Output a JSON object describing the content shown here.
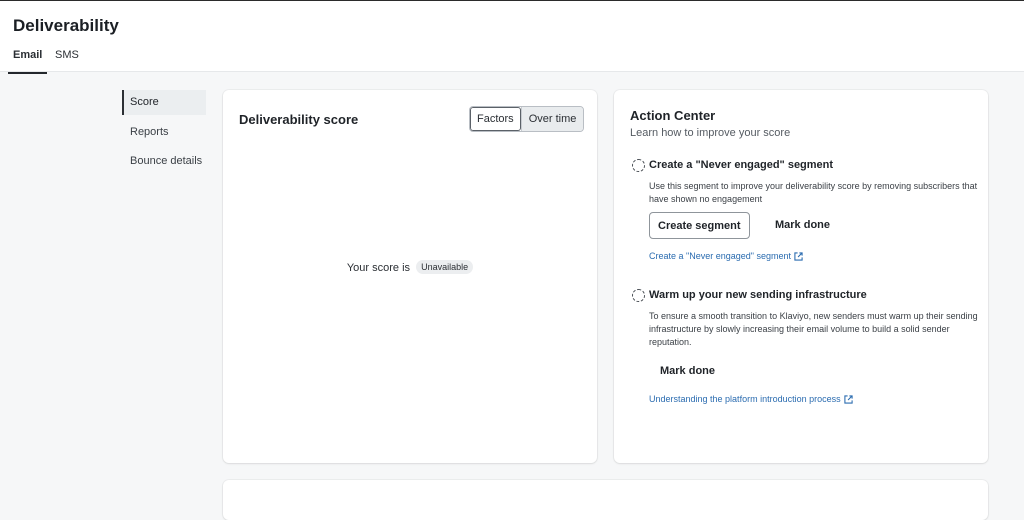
{
  "header": {
    "title": "Deliverability",
    "tabs": [
      {
        "label": "Email",
        "active": true
      },
      {
        "label": "SMS",
        "active": false
      }
    ]
  },
  "sidenav": {
    "items": [
      {
        "label": "Score",
        "active": true
      },
      {
        "label": "Reports",
        "active": false
      },
      {
        "label": "Bounce details",
        "active": false
      }
    ]
  },
  "score_card": {
    "title": "Deliverability score",
    "toggle": {
      "options": [
        "Factors",
        "Over time"
      ],
      "selected": "Factors"
    },
    "score_prefix": "Your score is",
    "score_badge": "Unavailable"
  },
  "action_center": {
    "title": "Action Center",
    "subtitle": "Learn how to improve your score",
    "tasks": [
      {
        "title": "Create a \"Never engaged\" segment",
        "description": "Use this segment to improve your deliverability score by removing subscribers that have shown no engagement",
        "primary_button": "Create segment",
        "secondary_button": "Mark done",
        "link": "Create a \"Never engaged\" segment",
        "icon": "dashed-circle-icon",
        "link_icon": "external-link-icon"
      },
      {
        "title": "Warm up your new sending infrastructure",
        "description": "To ensure a smooth transition to Klaviyo, new senders must warm up their sending infrastructure by slowly increasing their email volume to build a solid sender reputation.",
        "secondary_button": "Mark done",
        "link": "Understanding the platform introduction process",
        "icon": "dashed-circle-icon",
        "link_icon": "external-link-icon"
      }
    ]
  },
  "colors": {
    "link": "#2b6cb0",
    "background": "#f6f7f8",
    "card": "#ffffff"
  }
}
